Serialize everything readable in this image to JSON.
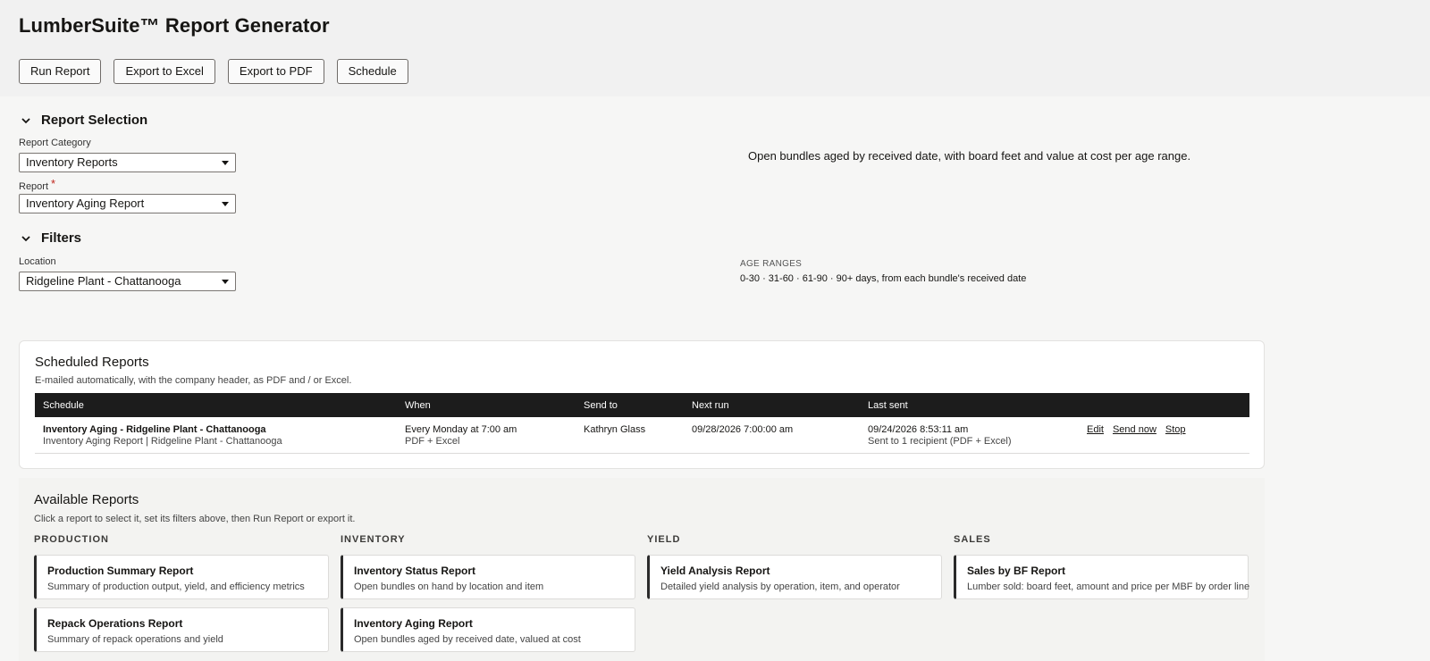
{
  "app": {
    "title": "LumberSuite™ Report Generator"
  },
  "toolbar": {
    "run_label": "Run Report",
    "excel_label": "Export to Excel",
    "pdf_label": "Export to PDF",
    "schedule_label": "Schedule"
  },
  "report_selection": {
    "title": "Report Selection",
    "category_label": "Report Category",
    "category_value": "Inventory Reports",
    "report_label": "Report",
    "report_required": "*",
    "report_value": "Inventory Aging Report",
    "description": "Open bundles aged by received date, with board feet and value at cost per age range."
  },
  "filters": {
    "title": "Filters",
    "location_label": "Location",
    "location_value": "Ridgeline Plant - Chattanooga",
    "age_ranges_label": "AGE RANGES",
    "age_ranges_text": "0-30 · 31-60 · 61-90 · 90+ days, from each bundle's received date"
  },
  "scheduled": {
    "title": "Scheduled Reports",
    "subtitle": "E-mailed automatically, with the company header, as PDF and / or Excel.",
    "columns": [
      "Schedule",
      "When",
      "Send to",
      "Next run",
      "Last sent"
    ],
    "rows": [
      {
        "name": "Inventory Aging - Ridgeline Plant - Chattanooga",
        "detail": "Inventory Aging Report | Ridgeline Plant - Chattanooga",
        "when": "Every Monday at 7:00 am",
        "format": "PDF + Excel",
        "send_to": "Kathryn Glass",
        "next_run": "09/28/2026 7:00:00 am",
        "last_sent": "09/24/2026 8:53:11 am",
        "last_sent_detail": "Sent to 1 recipient (PDF + Excel)",
        "actions": {
          "edit": "Edit",
          "send_now": "Send now",
          "stop": "Stop"
        }
      }
    ]
  },
  "available": {
    "title": "Available Reports",
    "subtitle": "Click a report to select it, set its filters above, then Run Report or export it.",
    "categories": [
      {
        "label": "PRODUCTION",
        "reports": [
          {
            "title": "Production Summary Report",
            "desc": "Summary of production output, yield, and efficiency metrics"
          },
          {
            "title": "Repack Operations Report",
            "desc": "Summary of repack operations and yield"
          }
        ]
      },
      {
        "label": "INVENTORY",
        "reports": [
          {
            "title": "Inventory Status Report",
            "desc": "Open bundles on hand by location and item"
          },
          {
            "title": "Inventory Aging Report",
            "desc": "Open bundles aged by received date, valued at cost"
          }
        ]
      },
      {
        "label": "YIELD",
        "reports": [
          {
            "title": "Yield Analysis Report",
            "desc": "Detailed yield analysis by operation, item, and operator"
          }
        ]
      },
      {
        "label": "SALES",
        "reports": [
          {
            "title": "Sales by BF Report",
            "desc": "Lumber sold: board feet, amount and price per MBF by order line"
          }
        ]
      }
    ]
  }
}
